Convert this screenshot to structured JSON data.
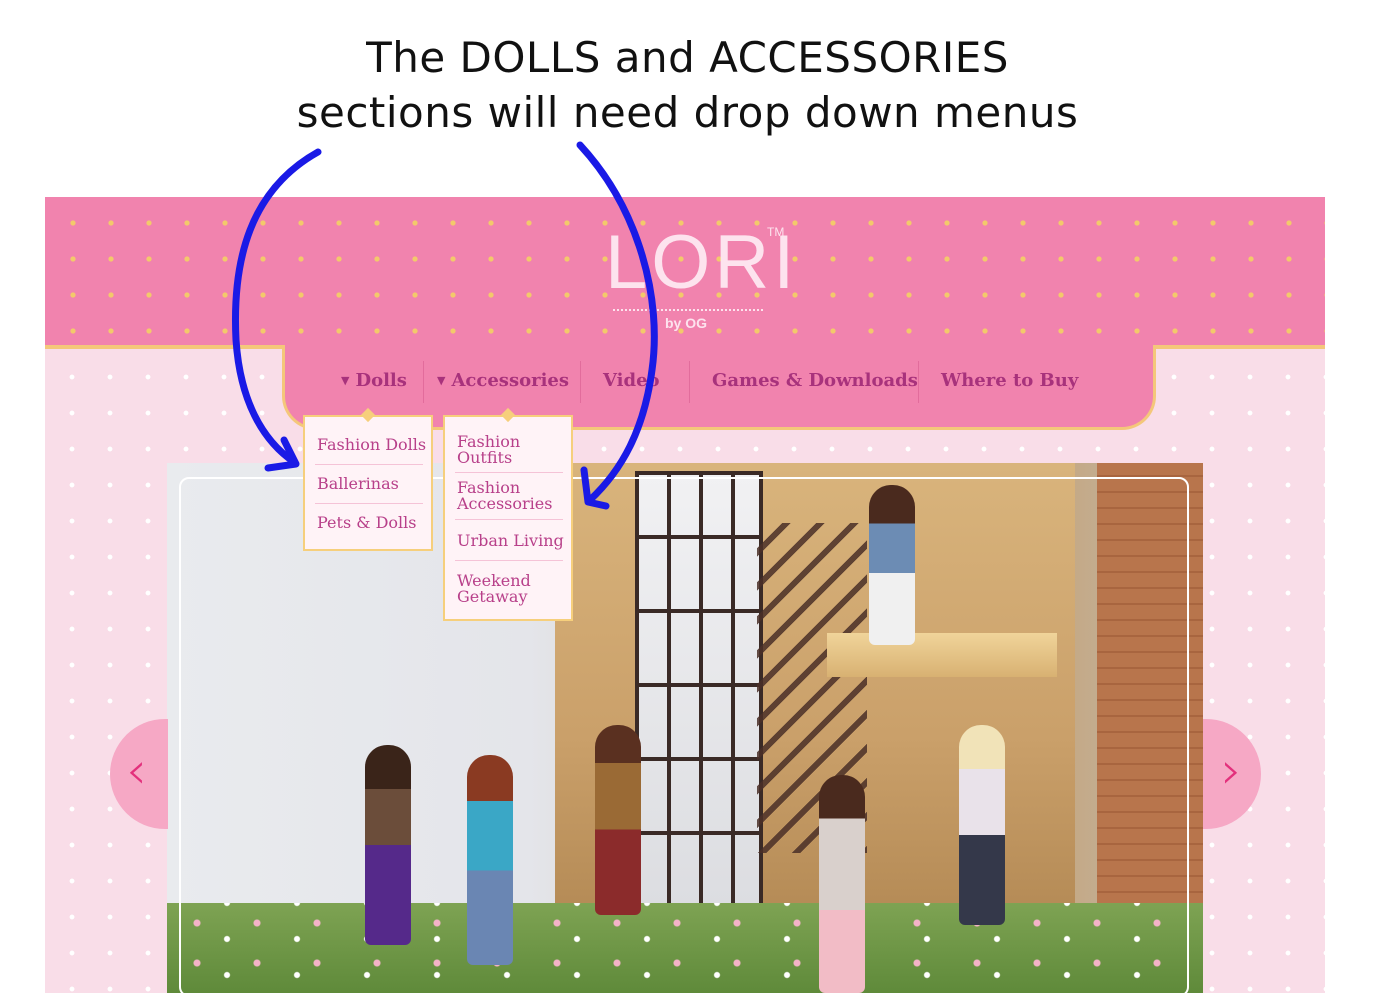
{
  "annotation": {
    "line1": "The DOLLS and ACCESSORIES",
    "line2": "sections will need drop down menus"
  },
  "logo": {
    "word": "LORI",
    "trademark": "TM",
    "byline": "by OG"
  },
  "nav": {
    "items": [
      {
        "label": "Dolls",
        "has_dropdown": true
      },
      {
        "label": "Accessories",
        "has_dropdown": true
      },
      {
        "label": "Video",
        "has_dropdown": false
      },
      {
        "label": "Games & Downloads",
        "has_dropdown": false
      },
      {
        "label": "Where to Buy",
        "has_dropdown": false
      }
    ],
    "caret_glyph": "▼"
  },
  "dolls_menu": {
    "items": [
      "Fashion Dolls",
      "Ballerinas",
      "Pets & Dolls"
    ]
  },
  "accessories_menu": {
    "items": [
      {
        "line1": "Fashion",
        "line2": "Outfits"
      },
      {
        "line1": "Fashion",
        "line2": "Accessories"
      },
      {
        "line1": "Urban Living",
        "line2": ""
      },
      {
        "line1": "Weekend",
        "line2": "Getaway"
      }
    ]
  },
  "carousel": {
    "prev_glyph": "‹",
    "next_glyph": "›"
  },
  "colors": {
    "header_pink": "#f183ae",
    "page_pink": "#f9dde8",
    "gold": "#f4c77a",
    "nav_text": "#a8327c",
    "menu_text": "#b8408a",
    "annotation_arrow": "#1a1ae6"
  },
  "icons": {
    "caret": "caret-down-icon",
    "prev": "chevron-left-icon",
    "next": "chevron-right-icon"
  }
}
